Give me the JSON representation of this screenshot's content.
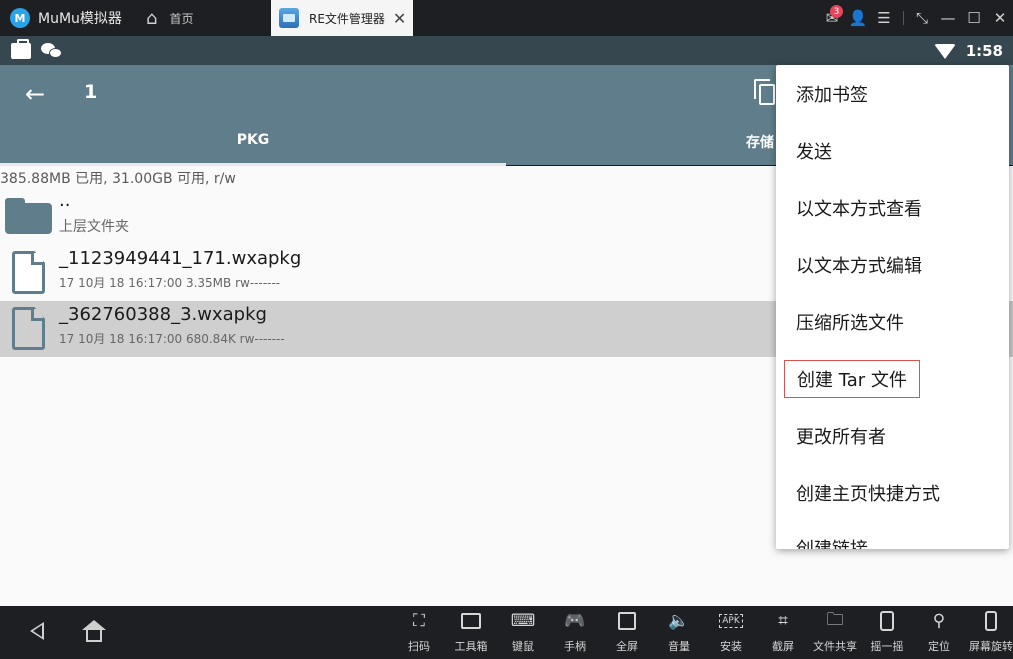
{
  "emulator": {
    "brand": "MuMu模拟器",
    "home_tab": "首页",
    "active_tab": "RE文件管理器",
    "notification_count": "3"
  },
  "status_bar": {
    "time": "1:58"
  },
  "toolbar": {
    "title": "1",
    "tabs": [
      {
        "label": "PKG"
      },
      {
        "label": "存储"
      }
    ]
  },
  "content": {
    "storage_info": "385.88MB 已用, 31.00GB 可用, r/w",
    "items": [
      {
        "name": "..",
        "meta": "上层文件夹"
      },
      {
        "name": "_1123949441_171.wxapkg",
        "meta": "17 10月 18 16:17:00  3.35MB  rw-------"
      },
      {
        "name": "_362760388_3.wxapkg",
        "meta": "17 10月 18 16:17:00  680.84K  rw-------"
      }
    ]
  },
  "menu": {
    "items": [
      "添加书签",
      "发送",
      "以文本方式查看",
      "以文本方式编辑",
      "压缩所选文件",
      "创建 Tar 文件",
      "更改所有者",
      "创建主页快捷方式",
      "创建链接"
    ]
  },
  "bottom_tools": [
    {
      "label": "扫码",
      "icon": "scan-icon"
    },
    {
      "label": "工具箱",
      "icon": "toolbox-icon"
    },
    {
      "label": "键鼠",
      "icon": "keyboard-icon"
    },
    {
      "label": "手柄",
      "icon": "gamepad-icon"
    },
    {
      "label": "全屏",
      "icon": "fullscreen-icon"
    },
    {
      "label": "音量",
      "icon": "volume-icon"
    },
    {
      "label": "安装",
      "icon": "apk-install-icon"
    },
    {
      "label": "截屏",
      "icon": "crop-icon"
    },
    {
      "label": "文件共享",
      "icon": "folder-icon"
    },
    {
      "label": "摇一摇",
      "icon": "shake-icon"
    },
    {
      "label": "定位",
      "icon": "location-icon"
    },
    {
      "label": "屏幕旋转",
      "icon": "rotate-icon"
    }
  ]
}
